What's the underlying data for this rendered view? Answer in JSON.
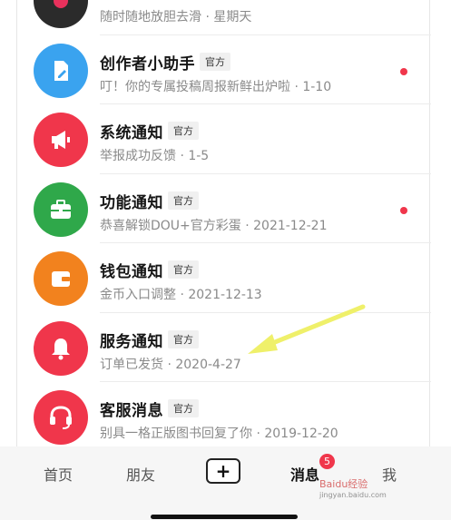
{
  "messages": [
    {
      "title": "",
      "badge": "",
      "subtitle": "随时随地放胆去滑 · 星期天",
      "color": "#2b2b2b",
      "icon": "partial-avatar",
      "unread": false
    },
    {
      "title": "创作者小助手",
      "badge": "官方",
      "subtitle": "叮！你的专属投稿周报新鲜出炉啦 · 1-10",
      "color": "#3aa3ef",
      "icon": "edit-document-icon",
      "unread": true
    },
    {
      "title": "系统通知",
      "badge": "官方",
      "subtitle": "举报成功反馈 · 1-5",
      "color": "#f0364b",
      "icon": "megaphone-icon",
      "unread": false
    },
    {
      "title": "功能通知",
      "badge": "官方",
      "subtitle": "恭喜解锁DOU+官方彩蛋 · 2021-12-21",
      "color": "#2fa84a",
      "icon": "toolbox-icon",
      "unread": true
    },
    {
      "title": "钱包通知",
      "badge": "官方",
      "subtitle": "金币入口调整 · 2021-12-13",
      "color": "#f2821e",
      "icon": "wallet-icon",
      "unread": false
    },
    {
      "title": "服务通知",
      "badge": "官方",
      "subtitle": "订单已发货 · 2020-4-27",
      "color": "#f0364b",
      "icon": "bell-icon",
      "unread": false
    },
    {
      "title": "客服消息",
      "badge": "官方",
      "subtitle": "别具一格正版图书回复了你 · 2019-12-20",
      "color": "#f0364b",
      "icon": "headset-icon",
      "unread": false
    }
  ],
  "tabs": {
    "home": "首页",
    "friends": "朋友",
    "create": "+",
    "messages": "消息",
    "messages_count": "5",
    "me": "我"
  },
  "watermark": {
    "brand": "Baidu经验",
    "url": "jingyan.baidu.com"
  }
}
